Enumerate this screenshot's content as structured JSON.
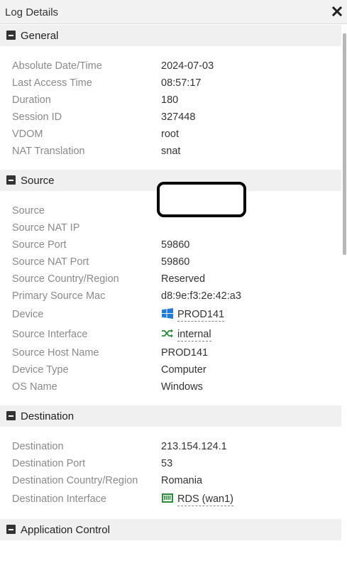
{
  "window": {
    "title": "Log Details"
  },
  "sections": {
    "general": {
      "title": "General",
      "rows": [
        {
          "label": "Absolute Date/Time",
          "value": "2024-07-03"
        },
        {
          "label": "Last Access Time",
          "value": "08:57:17"
        },
        {
          "label": "Duration",
          "value": "180"
        },
        {
          "label": "Session ID",
          "value": "327448"
        },
        {
          "label": "VDOM",
          "value": "root"
        },
        {
          "label": "NAT Translation",
          "value": "snat"
        }
      ]
    },
    "source": {
      "title": "Source",
      "rows": [
        {
          "label": "Source",
          "value": ""
        },
        {
          "label": "Source NAT IP",
          "value": ""
        },
        {
          "label": "Source Port",
          "value": "59860"
        },
        {
          "label": "Source NAT Port",
          "value": "59860"
        },
        {
          "label": "Source Country/Region",
          "value": "Reserved"
        },
        {
          "label": "Primary Source Mac",
          "value": "d8:9e:f3:2e:42:a3"
        },
        {
          "label": "Device",
          "value": "PROD141",
          "icon": "windows-icon"
        },
        {
          "label": "Source Interface",
          "value": "internal",
          "icon": "interface-shuffle-icon"
        },
        {
          "label": "Source Host Name",
          "value": "PROD141"
        },
        {
          "label": "Device Type",
          "value": "Computer"
        },
        {
          "label": "OS Name",
          "value": "Windows"
        }
      ]
    },
    "destination": {
      "title": "Destination",
      "rows": [
        {
          "label": "Destination",
          "value": "213.154.124.1"
        },
        {
          "label": "Destination Port",
          "value": "53"
        },
        {
          "label": "Destination Country/Region",
          "value": "Romania"
        },
        {
          "label": "Destination Interface",
          "value": "RDS (wan1)",
          "icon": "network-port-icon"
        }
      ]
    },
    "application_control": {
      "title": "Application Control"
    }
  },
  "colors": {
    "label": "#8a8a8a",
    "value": "#333333",
    "header_bg": "#f0f0f0",
    "windows_blue": "#1e7bd6",
    "interface_green": "#2e8b3a"
  }
}
